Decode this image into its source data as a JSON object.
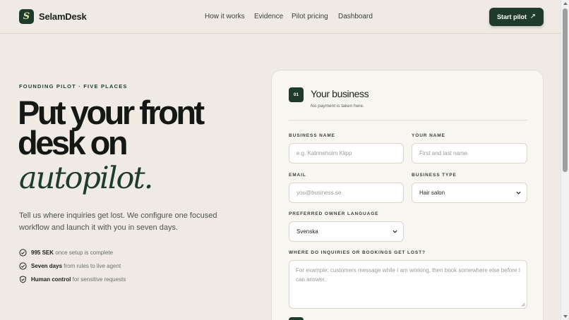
{
  "header": {
    "logo_letter": "S",
    "brand": "SelamDesk",
    "nav": [
      "How it works",
      "Evidence",
      "Pilot pricing",
      "Dashboard"
    ],
    "cta_label": "Start pilot",
    "cta_icon": "arrow-up-right-icon"
  },
  "hero": {
    "eyebrow": "FOUNDING PILOT · FIVE PLACES",
    "headline_line1": "Put your front",
    "headline_line2": "desk on",
    "headline_italic": "autopilot.",
    "lede": "Tell us where inquiries get lost. We configure one focused workflow and launch it with you in seven days.",
    "features": [
      {
        "bold": "995 SEK",
        "text": " once setup is complete",
        "icon": "check-circle-icon"
      },
      {
        "bold": "Seven days",
        "text": " from rules to live agent",
        "icon": "check-circle-icon"
      },
      {
        "bold": "Human control",
        "text": " for sensitive requests",
        "icon": "shield-check-icon"
      }
    ]
  },
  "form": {
    "step": "01",
    "title": "Your business",
    "subtitle": "No payment is taken here.",
    "business_name_label": "BUSINESS NAME",
    "business_name_placeholder": "e.g. Katrineholm Klipp",
    "your_name_label": "YOUR NAME",
    "your_name_placeholder": "First and last name",
    "email_label": "EMAIL",
    "email_placeholder": "you@business.se",
    "business_type_label": "BUSINESS TYPE",
    "business_type_value": "Hair salon",
    "language_label": "PREFERRED OWNER LANGUAGE",
    "language_value": "Svenska",
    "inquiries_label": "WHERE DO INQUIRIES OR BOOKINGS GET LOST?",
    "inquiries_placeholder": "For example: customers message while I am working, then book somewhere else before I can answer."
  },
  "colors": {
    "background": "#efebe4",
    "brand_green": "#1f3b2a",
    "card": "#f8f6f1"
  }
}
